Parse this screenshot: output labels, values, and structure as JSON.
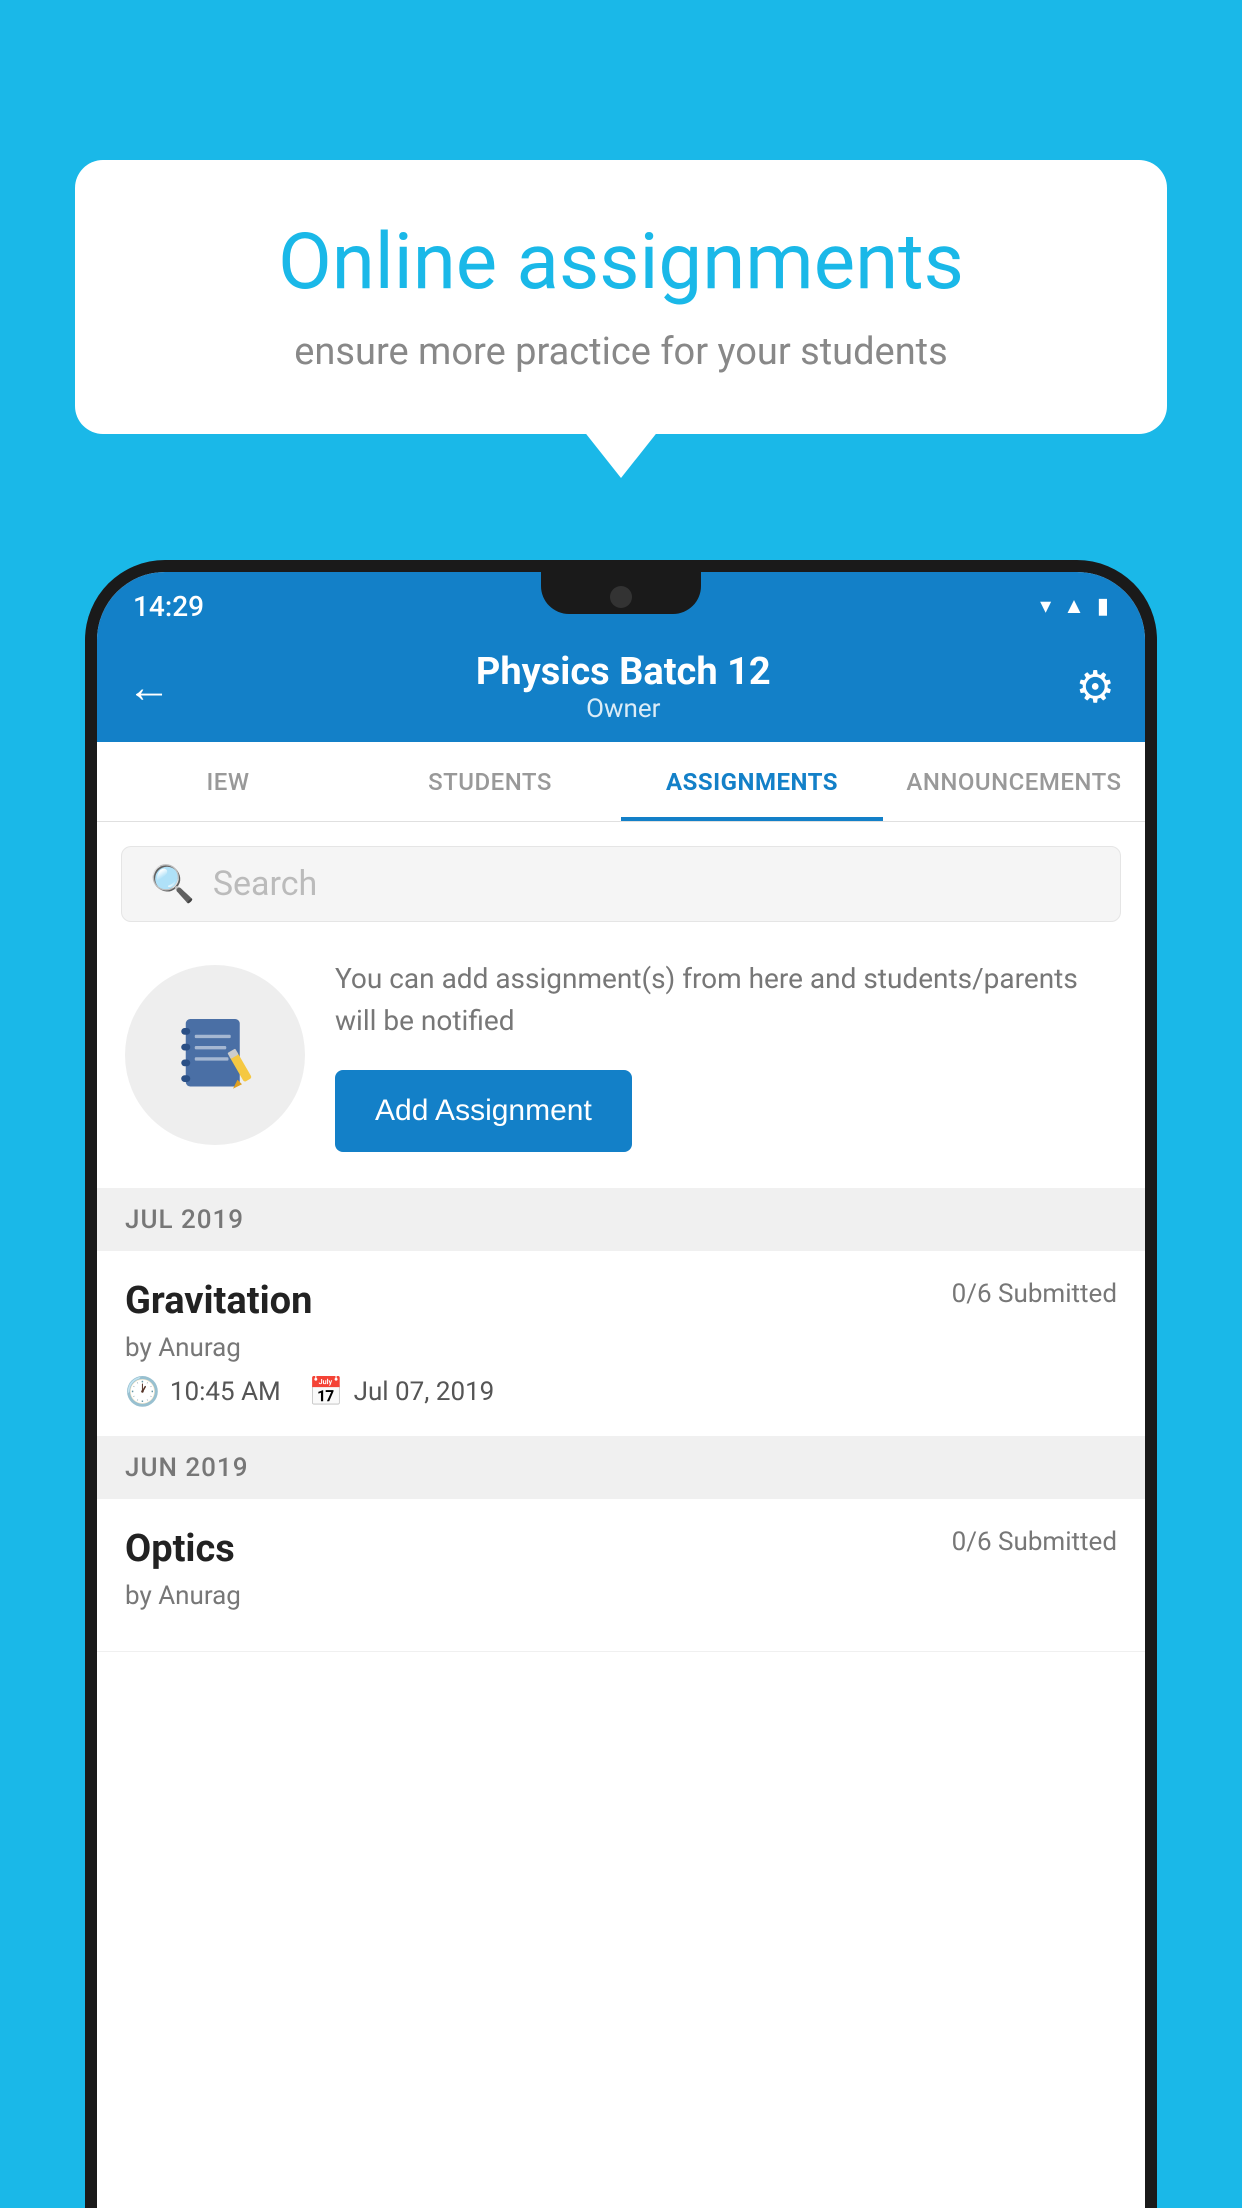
{
  "background": {
    "color": "#1ab8e8"
  },
  "speech_bubble": {
    "title": "Online assignments",
    "subtitle": "ensure more practice for your students"
  },
  "status_bar": {
    "time": "14:29",
    "icons": [
      "wifi",
      "signal",
      "battery"
    ]
  },
  "app_header": {
    "title": "Physics Batch 12",
    "subtitle": "Owner",
    "back_label": "←",
    "settings_label": "⚙"
  },
  "tabs": [
    {
      "label": "IEW",
      "active": false
    },
    {
      "label": "STUDENTS",
      "active": false
    },
    {
      "label": "ASSIGNMENTS",
      "active": true
    },
    {
      "label": "ANNOUNCEMENTS",
      "active": false
    }
  ],
  "search": {
    "placeholder": "Search"
  },
  "add_assignment": {
    "description": "You can add assignment(s) from here and students/parents will be notified",
    "button_label": "Add Assignment"
  },
  "sections": [
    {
      "header": "JUL 2019",
      "assignments": [
        {
          "name": "Gravitation",
          "submitted": "0/6 Submitted",
          "author": "by Anurag",
          "time": "10:45 AM",
          "date": "Jul 07, 2019"
        }
      ]
    },
    {
      "header": "JUN 2019",
      "assignments": [
        {
          "name": "Optics",
          "submitted": "0/6 Submitted",
          "author": "by Anurag",
          "time": "",
          "date": ""
        }
      ]
    }
  ]
}
